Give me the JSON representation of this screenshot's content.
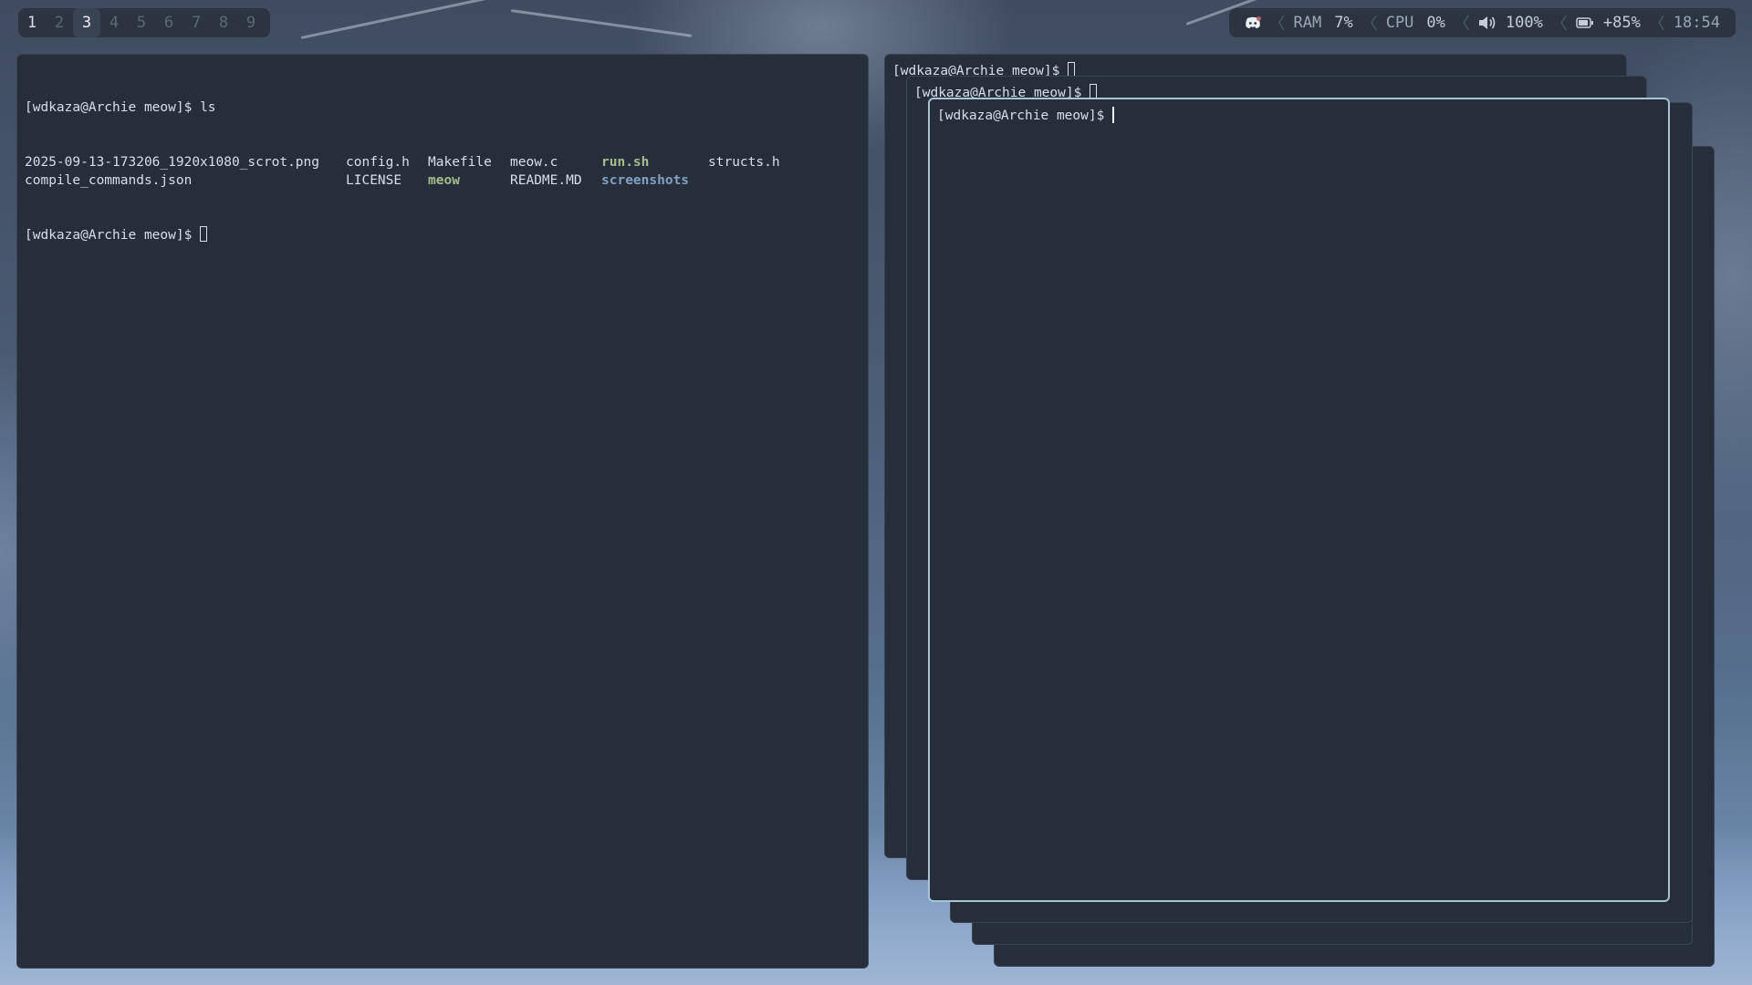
{
  "topbar": {
    "workspaces": [
      {
        "label": "1",
        "state": "occupied"
      },
      {
        "label": "2",
        "state": "empty"
      },
      {
        "label": "3",
        "state": "active"
      },
      {
        "label": "4",
        "state": "empty"
      },
      {
        "label": "5",
        "state": "empty"
      },
      {
        "label": "6",
        "state": "empty"
      },
      {
        "label": "7",
        "state": "empty"
      },
      {
        "label": "8",
        "state": "empty"
      },
      {
        "label": "9",
        "state": "empty"
      }
    ],
    "status": {
      "discord_icon": "discord-icon",
      "ram_label": "RAM",
      "ram_value": "7%",
      "cpu_label": "CPU",
      "cpu_value": "0%",
      "volume_icon": "speaker-icon",
      "volume_value": "100%",
      "battery_icon": "battery-icon",
      "battery_value": "+85%",
      "clock": "18:54"
    }
  },
  "terminal_left": {
    "prompt": "[wdkaza@Archie meow]$ ",
    "command": "ls",
    "ls_rows": [
      [
        {
          "name": "2025-09-13-173206_1920x1080_scrot.png",
          "kind": "file"
        },
        {
          "name": "config.h",
          "kind": "file"
        },
        {
          "name": "Makefile",
          "kind": "file"
        },
        {
          "name": "meow.c",
          "kind": "file"
        },
        {
          "name": "run.sh",
          "kind": "exec"
        },
        {
          "name": "structs.h",
          "kind": "file"
        }
      ],
      [
        {
          "name": "compile_commands.json",
          "kind": "file"
        },
        {
          "name": "LICENSE",
          "kind": "file"
        },
        {
          "name": "meow",
          "kind": "exec"
        },
        {
          "name": "README.MD",
          "kind": "file"
        },
        {
          "name": "screenshots",
          "kind": "dir"
        },
        {
          "name": "",
          "kind": "file"
        }
      ]
    ],
    "prompt2": "[wdkaza@Archie meow]$ "
  },
  "stack_terminals": {
    "back_prompt": "[wdkaza@Archie meow]$ ",
    "middle_prompt": "[wdkaza@Archie meow]$ ",
    "front_prompt": "[wdkaza@Archie meow]$ "
  },
  "colors": {
    "terminal_bg": "#272e3b",
    "focus_border": "#a7c5d6",
    "exec_color": "#a3be8c",
    "dir_color": "#81a1c1"
  }
}
